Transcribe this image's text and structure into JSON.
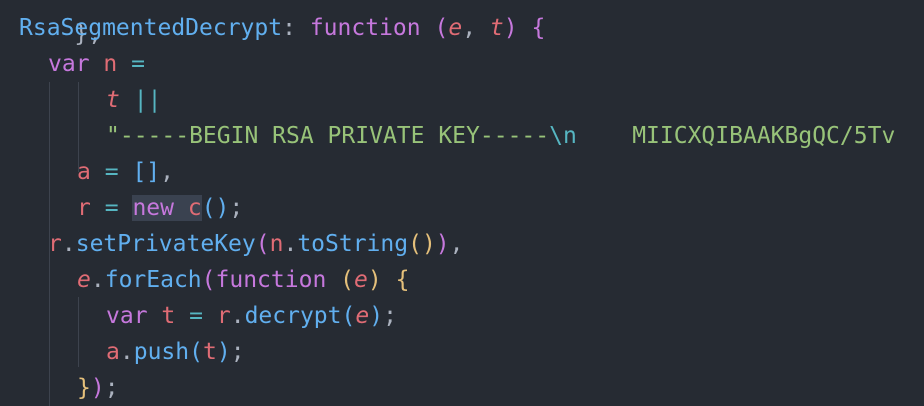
{
  "code": {
    "line0_tail": "},",
    "line1": {
      "name": "RsaSegmentedDecrypt",
      "colon": ":",
      "kw": "function",
      "open": "(",
      "p1": "e",
      "comma": ",",
      "p2": "t",
      "close": ")",
      "brace": "{"
    },
    "line2": {
      "kw": "var",
      "name": "n",
      "eq": "="
    },
    "line3": {
      "name": "t",
      "op": "||"
    },
    "line4": {
      "str_start": "\"-----BEGIN RSA PRIVATE KEY-----",
      "esc": "\\n",
      "str_rest": "    MIICXQIBAAKBgQC/5Tv"
    },
    "line5": {
      "name": "a",
      "eq": "=",
      "val": "[]",
      "comma": ","
    },
    "line6": {
      "name": "r",
      "eq": "=",
      "kw": "new",
      "cls": "c",
      "call": "()",
      "semi": ";"
    },
    "line7": {
      "obj": "r",
      "dot": ".",
      "method": "setPrivateKey",
      "open": "(",
      "arg": "n",
      "dot2": ".",
      "method2": "toString",
      "call": "()",
      "close": ")",
      "comma": ","
    },
    "line8": {
      "obj": "e",
      "dot": ".",
      "method": "forEach",
      "open": "(",
      "kw": "function",
      "popen": "(",
      "param": "e",
      "pclose": ")",
      "brace": "{"
    },
    "line9": {
      "kw": "var",
      "name": "t",
      "eq": "=",
      "obj": "r",
      "dot": ".",
      "method": "decrypt",
      "open": "(",
      "param": "e",
      "close": ")",
      "semi": ";"
    },
    "line10": {
      "obj": "a",
      "dot": ".",
      "method": "push",
      "open": "(",
      "arg": "t",
      "close": ")",
      "semi": ";"
    },
    "line11": {
      "brace": "}",
      "close": ")",
      "semi": ";"
    }
  },
  "colors": {
    "background": "#262b33",
    "function_name": "#61afef",
    "keyword": "#c678dd",
    "variable": "#e06c75",
    "string": "#98c379",
    "operator": "#56b6c2"
  }
}
